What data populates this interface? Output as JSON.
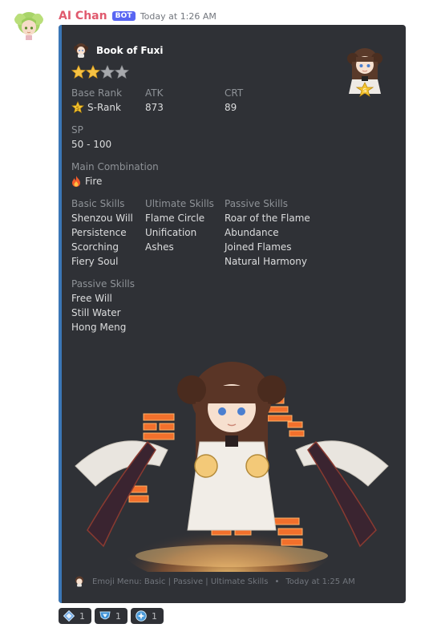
{
  "message": {
    "username": "AI Chan",
    "bot_tag": "BOT",
    "timestamp": "Today at 1:26 AM"
  },
  "embed": {
    "author": "Book of Fuxi",
    "rating": {
      "filled": 2,
      "total": 4
    },
    "fields": {
      "base_rank": {
        "name": "Base Rank",
        "value": "S-Rank"
      },
      "atk": {
        "name": "ATK",
        "value": "873"
      },
      "crt": {
        "name": "CRT",
        "value": "89"
      },
      "sp": {
        "name": "SP",
        "value": "50 - 100"
      },
      "main_combination": {
        "name": "Main Combination",
        "value": "Fire"
      },
      "basic_skills": {
        "name": "Basic Skills",
        "items": [
          "Shenzou Will",
          "Persistence",
          "Scorching",
          "Fiery Soul"
        ]
      },
      "ultimate_skills": {
        "name": "Ultimate Skills",
        "items": [
          "Flame Circle",
          "Unification",
          "Ashes"
        ]
      },
      "passive_skills": {
        "name": "Passive Skills",
        "items": [
          "Roar of the Flame",
          "Abundance",
          "Joined Flames",
          "Natural Harmony"
        ]
      },
      "passive_skills_2": {
        "name": "Passive Skills",
        "items": [
          "Free Will",
          "Still Water",
          "Hong Meng"
        ]
      }
    },
    "footer": {
      "text": "Emoji Menu: Basic | Passive | Ultimate Skills",
      "separator": "•",
      "timestamp": "Today at 1:25 AM"
    },
    "accent_color": "#3b77b7"
  },
  "reactions": [
    {
      "icon": "basic-skill-emoji",
      "count": "1"
    },
    {
      "icon": "passive-skill-emoji",
      "count": "1"
    },
    {
      "icon": "ultimate-skill-emoji",
      "count": "1"
    }
  ]
}
